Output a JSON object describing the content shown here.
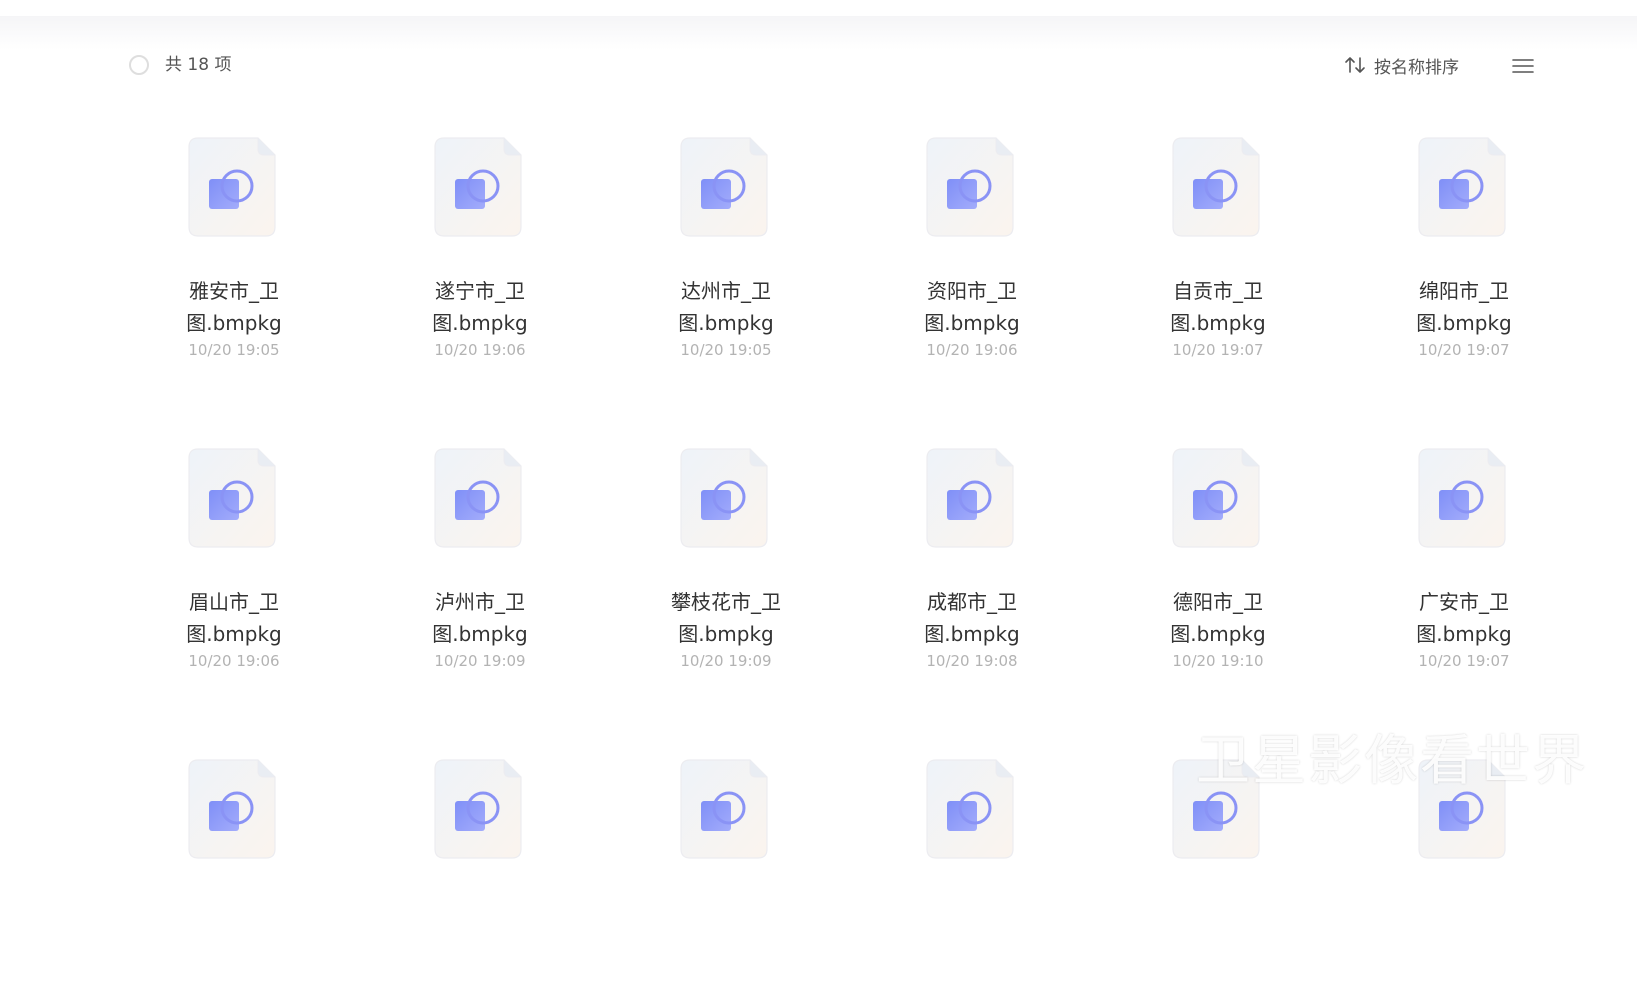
{
  "toolbar": {
    "count_label": "共 18 项",
    "sort_label": "按名称排序"
  },
  "files": [
    {
      "name_line1": "雅安市_卫",
      "name_line2": "图.bmpkg",
      "time": "10/20 19:05"
    },
    {
      "name_line1": "遂宁市_卫",
      "name_line2": "图.bmpkg",
      "time": "10/20 19:06"
    },
    {
      "name_line1": "达州市_卫",
      "name_line2": "图.bmpkg",
      "time": "10/20 19:05"
    },
    {
      "name_line1": "资阳市_卫",
      "name_line2": "图.bmpkg",
      "time": "10/20 19:06"
    },
    {
      "name_line1": "自贡市_卫",
      "name_line2": "图.bmpkg",
      "time": "10/20 19:07"
    },
    {
      "name_line1": "绵阳市_卫",
      "name_line2": "图.bmpkg",
      "time": "10/20 19:07"
    },
    {
      "name_line1": "眉山市_卫",
      "name_line2": "图.bmpkg",
      "time": "10/20 19:06"
    },
    {
      "name_line1": "泸州市_卫",
      "name_line2": "图.bmpkg",
      "time": "10/20 19:09"
    },
    {
      "name_line1": "攀枝花市_卫",
      "name_line2": "图.bmpkg",
      "time": "10/20 19:09"
    },
    {
      "name_line1": "成都市_卫",
      "name_line2": "图.bmpkg",
      "time": "10/20 19:08"
    },
    {
      "name_line1": "德阳市_卫",
      "name_line2": "图.bmpkg",
      "time": "10/20 19:10"
    },
    {
      "name_line1": "广安市_卫",
      "name_line2": "图.bmpkg",
      "time": "10/20 19:07"
    },
    {},
    {},
    {},
    {},
    {},
    {}
  ],
  "watermark": "卫星影像看世界",
  "colors": {
    "icon_accent": "#8a93f5",
    "muted_text": "#b3b3b3"
  }
}
